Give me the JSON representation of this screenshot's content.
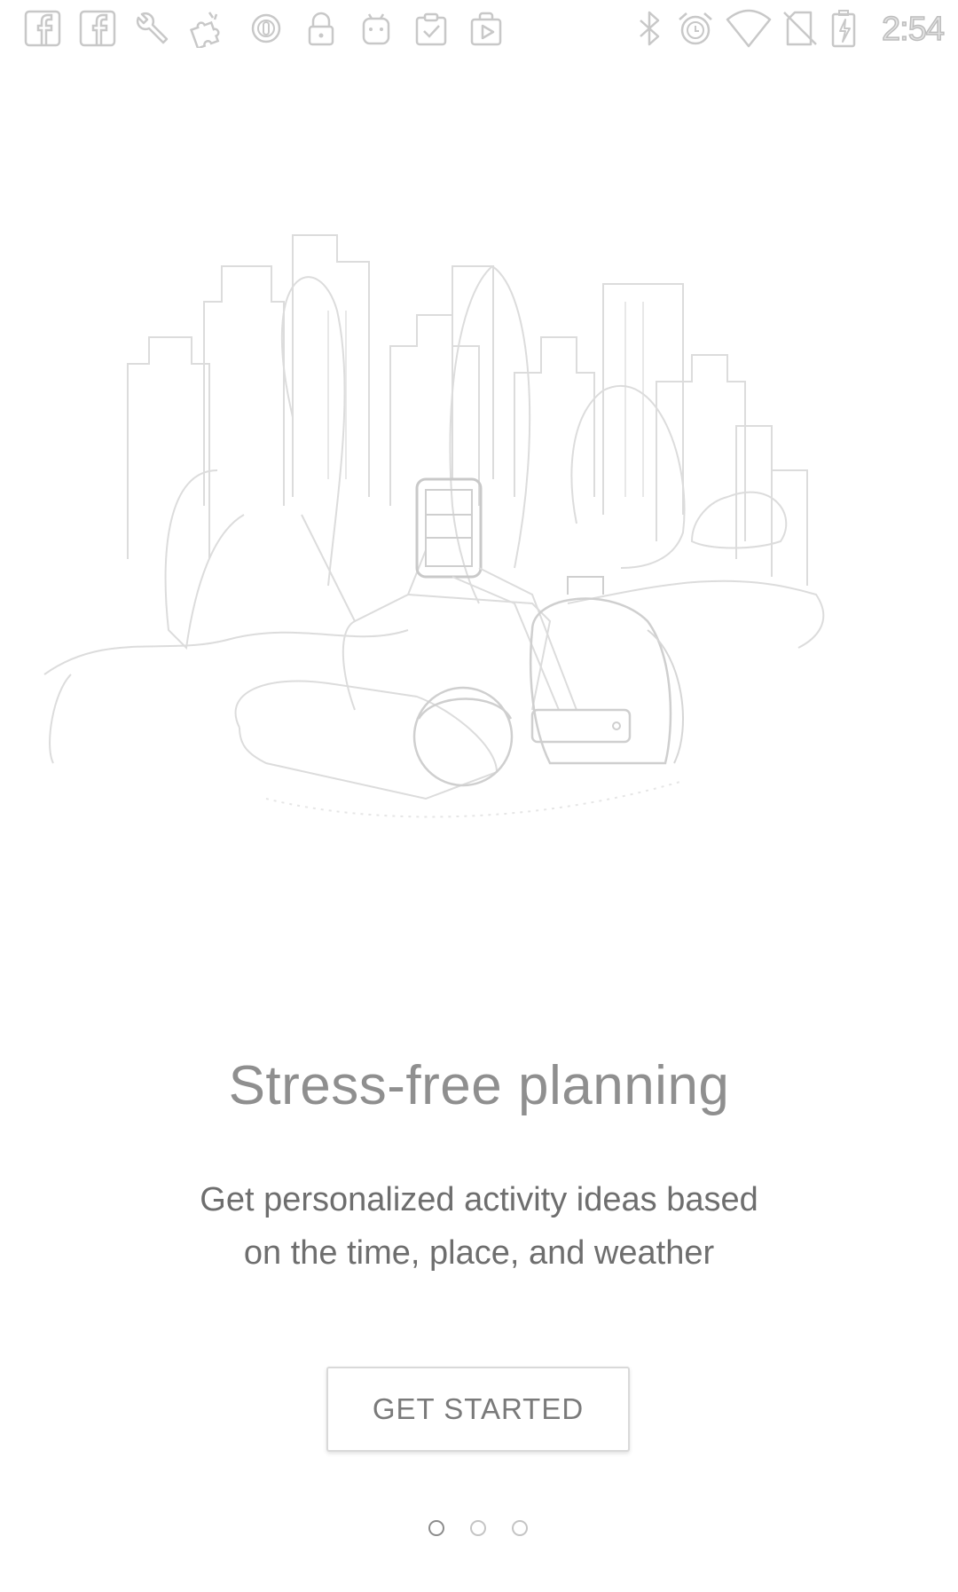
{
  "status_bar": {
    "time": "2:54",
    "left_icons": [
      "facebook-icon",
      "facebook-icon",
      "wrench-icon",
      "puzzle-icon",
      "circle-indicator-icon",
      "lock-icon",
      "android-icon",
      "clipboard-check-icon",
      "play-bag-icon"
    ],
    "right_icons": [
      "bluetooth-icon",
      "alarm-icon",
      "wifi-icon",
      "no-sim-icon",
      "battery-charging-icon"
    ]
  },
  "onboarding": {
    "title": "Stress-free planning",
    "subtitle_lines": [
      "Get personalized activity ideas based",
      "on the time, place, and weather"
    ],
    "button_label": "GET STARTED",
    "pages": {
      "current": 1,
      "total": 3
    }
  },
  "colors": {
    "background": "#ffffff",
    "title": "#8f8f8f",
    "body_text": "#6e6e6e",
    "button_border": "#d9d9d9",
    "dot_active": "#8c8c8c",
    "dot_inactive": "#c4c4c4"
  }
}
